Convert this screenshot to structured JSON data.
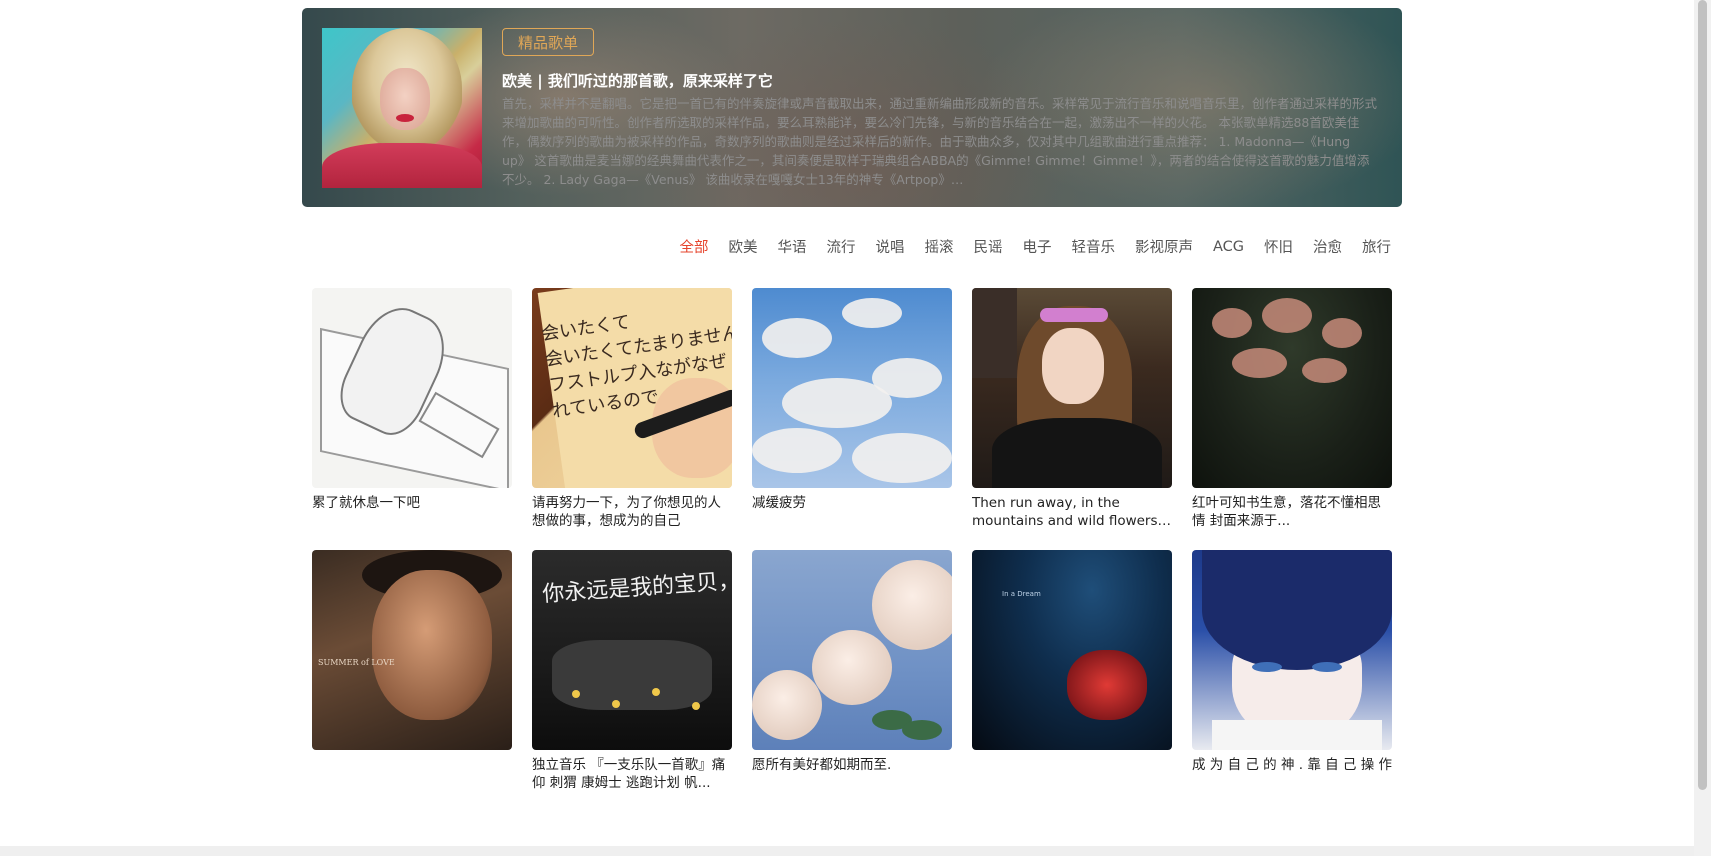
{
  "banner": {
    "tag": "精品歌单",
    "title": "欧美 | 我们听过的那首歌，原来采样了它",
    "description": "首先，采样并不是翻唱。它是把一首已有的伴奏旋律或声音截取出来，通过重新编曲形成新的音乐。采样常见于流行音乐和说唱音乐里，创作者通过采样的形式来增加歌曲的可听性。创作者所选取的采样作品，要么耳熟能详，要么冷门先锋，与新的音乐结合在一起，激荡出不一样的火花。 本张歌单精选88首欧美佳作，偶数序列的歌曲为被采样的作品，奇数序列的歌曲则是经过采样后的新作。由于歌曲众多，仅对其中几组歌曲进行重点推荐： 1. Madonna—《Hung up》 这首歌曲是麦当娜的经典舞曲代表作之一，其间奏便是取样于瑞典组合ABBA的《Gimme! Gimme！Gimme！》，两者的结合使得这首歌的魅力值增添不少。 2. Lady Gaga—《Venus》 该曲收录在嘎嘎女士13年的神专《Artpop》…"
  },
  "categories": [
    {
      "label": "全部",
      "active": true
    },
    {
      "label": "欧美",
      "active": false
    },
    {
      "label": "华语",
      "active": false
    },
    {
      "label": "流行",
      "active": false
    },
    {
      "label": "说唱",
      "active": false
    },
    {
      "label": "摇滚",
      "active": false
    },
    {
      "label": "民谣",
      "active": false
    },
    {
      "label": "电子",
      "active": false
    },
    {
      "label": "轻音乐",
      "active": false
    },
    {
      "label": "影视原声",
      "active": false
    },
    {
      "label": "ACG",
      "active": false
    },
    {
      "label": "怀旧",
      "active": false
    },
    {
      "label": "治愈",
      "active": false
    },
    {
      "label": "旅行",
      "active": false
    }
  ],
  "playlists": [
    {
      "title": "累了就休息一下吧"
    },
    {
      "title": "请再努力一下，为了你想见的人想做的事，想成为的自己"
    },
    {
      "title": "减缓疲劳"
    },
    {
      "title": "Then run away, in the mountains and wild flowers, in the sun"
    },
    {
      "title": "红叶可知书生意，落花不懂相思情 封面来源于..."
    },
    {
      "title": ""
    },
    {
      "title": "独立音乐 『一支乐队一首歌』痛仰 刺猬 康姆士 逃跑计划 帆..."
    },
    {
      "title": "愿所有美好都如期而至."
    },
    {
      "title": ""
    },
    {
      "title": "成 为 自 己 的 神 . 靠 自 己 操 作"
    }
  ],
  "cover_text": {
    "c2": "会いたくて\n会いたくてたまりません\nフストルプ入ながなぜ\nれているので",
    "c6": "SUMMER of LOVE",
    "c7": "你永远是我的宝贝，宝贝",
    "c9": "In a Dream"
  },
  "colors": {
    "accent_active": "#e6442d",
    "tag_gold": "#e0a757"
  }
}
